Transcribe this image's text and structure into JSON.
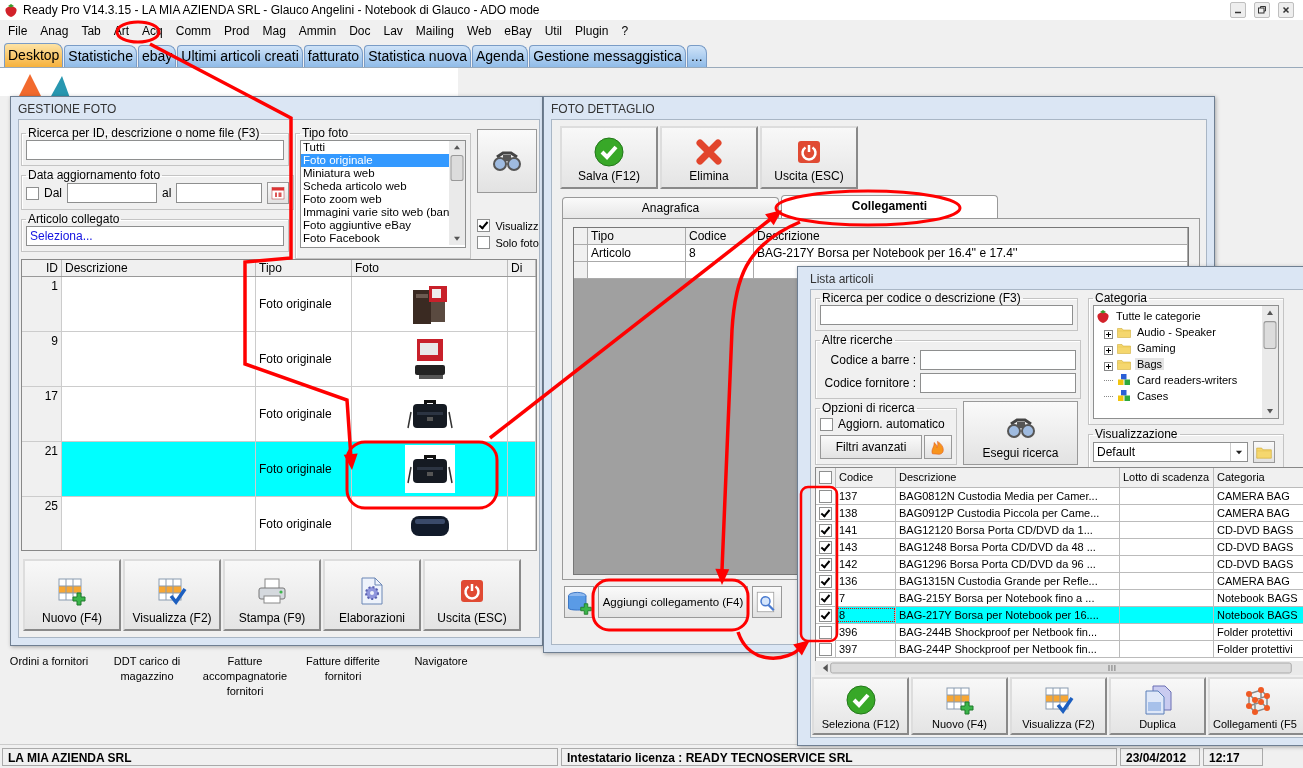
{
  "window": {
    "title": "Ready Pro V14.3.15 - LA MIA AZIENDA SRL - Glauco Angelini - Notebook di Glauco - ADO mode"
  },
  "menu": [
    "File",
    "Anag",
    "Tab",
    "Art",
    "Acq",
    "Comm",
    "Prod",
    "Mag",
    "Ammin",
    "Doc",
    "Lav",
    "Mailing",
    "Web",
    "eBay",
    "Util",
    "Plugin",
    "?"
  ],
  "tabs": [
    {
      "label": "Desktop",
      "selected": true
    },
    {
      "label": "Statistiche",
      "selected": false
    },
    {
      "label": "ebay",
      "selected": false
    },
    {
      "label": "Ultimi articoli creati",
      "selected": false
    },
    {
      "label": "fatturato",
      "selected": false
    },
    {
      "label": "Statistica nuova",
      "selected": false
    },
    {
      "label": "Agenda",
      "selected": false
    },
    {
      "label": "Gestione messaggistica",
      "selected": false
    },
    {
      "label": "...",
      "selected": false
    }
  ],
  "desktop_shortcuts": [
    "Ordini a fornitori",
    "DDT carico di magazzino",
    "Fatture accompagnatorie fornitori",
    "Fatture differite fornitori",
    "Navigatore"
  ],
  "gestione_foto": {
    "title": "GESTIONE FOTO",
    "search": {
      "label": "Ricerca per ID, descrizione o nome file (F3)"
    },
    "date_filter": {
      "label": "Data aggiornamento foto",
      "from_label": "Dal",
      "from_checked": false,
      "to_label": "al"
    },
    "linked_article": {
      "label": "Articolo collegato",
      "value": "Seleziona..."
    },
    "photo_type": {
      "label": "Tipo foto",
      "items": [
        {
          "label": "Tutti",
          "selected": false
        },
        {
          "label": "Foto originale",
          "selected": true
        },
        {
          "label": "Miniatura web",
          "selected": false
        },
        {
          "label": "Scheda articolo web",
          "selected": false
        },
        {
          "label": "Foto zoom web",
          "selected": false
        },
        {
          "label": "Immagini varie sito web (ban",
          "selected": false
        },
        {
          "label": "Foto aggiuntive eBay",
          "selected": false
        },
        {
          "label": "Foto Facebook",
          "selected": false
        }
      ]
    },
    "options": [
      {
        "label": "Visualizz",
        "checked": true
      },
      {
        "label": "Solo foto",
        "checked": false
      }
    ],
    "table": {
      "columns": [
        "ID",
        "Descrizione",
        "Tipo",
        "Foto",
        "Di"
      ],
      "rows": [
        {
          "id": "1",
          "type": "Foto originale",
          "selected": false
        },
        {
          "id": "9",
          "type": "Foto originale",
          "selected": false
        },
        {
          "id": "17",
          "type": "Foto originale",
          "selected": false
        },
        {
          "id": "21",
          "type": "Foto originale",
          "selected": true
        },
        {
          "id": "25",
          "type": "Foto originale",
          "selected": false
        }
      ]
    },
    "buttons": [
      {
        "label": "Nuovo (F4)",
        "kind": "new"
      },
      {
        "label": "Visualizza (F2)",
        "kind": "view"
      },
      {
        "label": "Stampa (F9)",
        "kind": "print"
      },
      {
        "label": "Elaborazioni",
        "kind": "process"
      },
      {
        "label": "Uscita (ESC)",
        "kind": "exit"
      }
    ]
  },
  "foto_dettaglio": {
    "title": "FOTO DETTAGLIO",
    "buttons": [
      {
        "label": "Salva (F12)",
        "kind": "save"
      },
      {
        "label": "Elimina",
        "kind": "delete"
      },
      {
        "label": "Uscita (ESC)",
        "kind": "exit"
      }
    ],
    "tabs": [
      {
        "label": "Anagrafica",
        "selected": false
      },
      {
        "label": "Collegamenti",
        "selected": true
      }
    ],
    "table": {
      "columns": [
        "Tipo",
        "Codice",
        "Descrizione"
      ],
      "rows": [
        {
          "type": "Articolo",
          "code": "8",
          "description": "BAG-217Y Borsa per Notebook per 16.4'' e 17.4''"
        }
      ]
    },
    "add_button": {
      "label": "Aggiungi collegamento (F4)"
    }
  },
  "lista_articoli": {
    "title": "Lista articoli",
    "search": {
      "label": "Ricerca per codice o descrizione (F3)"
    },
    "other_search": {
      "label": "Altre ricerche",
      "fields": [
        "Codice a barre :",
        "Codice fornitore :"
      ]
    },
    "search_options": {
      "label": "Opzioni di ricerca",
      "auto_update": {
        "label": "Aggiorn. automatico",
        "checked": false
      },
      "filters_button": "Filtri avanzati"
    },
    "run_search_button": "Esegui ricerca",
    "category": {
      "label": "Categoria",
      "tree": [
        {
          "label": "Tutte le categorie",
          "kind": "root",
          "selected": false,
          "children": [
            {
              "label": "Audio - Speaker",
              "kind": "folder",
              "selected": false
            },
            {
              "label": "Gaming",
              "kind": "folder",
              "selected": false
            },
            {
              "label": "Bags",
              "kind": "folder",
              "selected": true
            },
            {
              "label": "Card readers-writers",
              "kind": "group",
              "selected": false
            },
            {
              "label": "Cases",
              "kind": "group",
              "selected": false
            }
          ]
        }
      ]
    },
    "view": {
      "label": "Visualizzazione",
      "value": "Default"
    },
    "table": {
      "header_checked": false,
      "columns": [
        "Codice",
        "Descrizione",
        "Lotto di scadenza",
        "Categoria"
      ],
      "rows": [
        {
          "checked": false,
          "selected": false,
          "code": "137",
          "description": "BAG0812N Custodia Media per Camer...",
          "category": "CAMERA BAG"
        },
        {
          "checked": true,
          "selected": false,
          "code": "138",
          "description": "BAG0912P Custodia Piccola per Came...",
          "category": "CAMERA BAG"
        },
        {
          "checked": true,
          "selected": false,
          "code": "141",
          "description": "BAG12120 Borsa Porta CD/DVD da 1...",
          "category": "CD-DVD BAGS"
        },
        {
          "checked": true,
          "selected": false,
          "code": "143",
          "description": "BAG1248 Borsa Porta CD/DVD da 48 ...",
          "category": "CD-DVD BAGS"
        },
        {
          "checked": true,
          "selected": false,
          "code": "142",
          "description": "BAG1296 Borsa Porta CD/DVD da 96 ...",
          "category": "CD-DVD BAGS"
        },
        {
          "checked": true,
          "selected": false,
          "code": "136",
          "description": "BAG1315N Custodia Grande per Refle...",
          "category": "CAMERA BAG"
        },
        {
          "checked": true,
          "selected": false,
          "code": "7",
          "description": "BAG-215Y Borsa per Notebook fino a ...",
          "category": "Notebook BAGS"
        },
        {
          "checked": true,
          "selected": true,
          "code": "8",
          "description": "BAG-217Y Borsa per Notebook per 16....",
          "category": "Notebook BAGS"
        },
        {
          "checked": false,
          "selected": false,
          "code": "396",
          "description": "BAG-244B Shockproof per Netbook fin...",
          "category": "Folder protettivi"
        },
        {
          "checked": false,
          "selected": false,
          "code": "397",
          "description": "BAG-244P Shockproof per Netbook fin...",
          "category": "Folder protettivi"
        }
      ]
    },
    "buttons": [
      {
        "label": "Seleziona (F12)",
        "kind": "select"
      },
      {
        "label": "Nuovo (F4)",
        "kind": "new"
      },
      {
        "label": "Visualizza (F2)",
        "kind": "view"
      },
      {
        "label": "Duplica",
        "kind": "duplicate"
      },
      {
        "label": "Collegamenti (F5",
        "kind": "links"
      }
    ]
  },
  "status_bar": [
    "LA MIA AZIENDA SRL",
    "Intestatario licenza : READY TECNOSERVICE SRL",
    "23/04/2012",
    "12:17"
  ]
}
